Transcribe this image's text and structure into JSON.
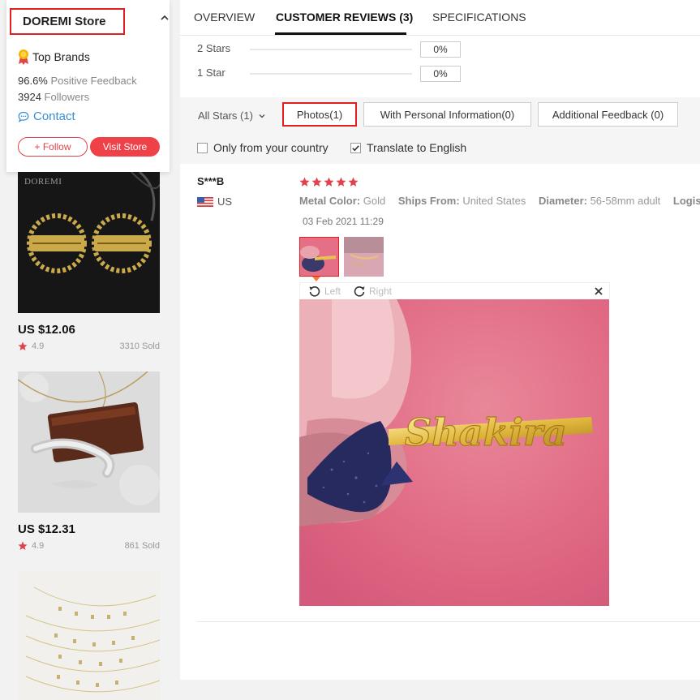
{
  "store": {
    "name": "DOREMI Store",
    "badge_label": "Top Brands",
    "positive_value": "96.6%",
    "positive_label": "Positive Feedback",
    "followers_value": "3924",
    "followers_label": "Followers",
    "contact_label": "Contact",
    "follow_label": "+ Follow",
    "visit_label": "Visit Store"
  },
  "products": [
    {
      "price": "US $12.06",
      "rating": "4.9",
      "sold": "3310 Sold",
      "image_watermark": "DOREMI"
    },
    {
      "price": "US $12.31",
      "rating": "4.9",
      "sold": "861 Sold"
    },
    {}
  ],
  "tabs": [
    {
      "label": "OVERVIEW",
      "active": false
    },
    {
      "label": "CUSTOMER REVIEWS (3)",
      "active": true
    },
    {
      "label": "SPECIFICATIONS",
      "active": false
    }
  ],
  "star_breakdown": [
    {
      "label": "2 Stars",
      "percent": "0%"
    },
    {
      "label": "1 Star",
      "percent": "0%"
    }
  ],
  "filters": {
    "all_stars": "All Stars (1)",
    "buttons": [
      "Photos(1)",
      "With Personal Information(0)",
      "Additional Feedback (0)"
    ],
    "only_country": {
      "label": "Only from your country",
      "checked": false
    },
    "translate": {
      "label": "Translate to English",
      "checked": true
    }
  },
  "review": {
    "reviewer": "S***B",
    "country": "US",
    "rating": 5,
    "attributes": [
      {
        "key": "Metal Color:",
        "value": "Gold"
      },
      {
        "key": "Ships From:",
        "value": "United States"
      },
      {
        "key": "Diameter:",
        "value": "56-58mm adult"
      },
      {
        "key": "Logisti",
        "value": ""
      }
    ],
    "date": "03 Feb 2021 11:29",
    "photo_count": 2
  },
  "viewer": {
    "rotate_left": "Left",
    "rotate_right": "Right",
    "photo_text": "Shakira"
  },
  "colors": {
    "accent_red": "#ef4148",
    "highlight_red": "#e02020",
    "link_blue": "#3a8fd3",
    "star_red": "#e0434a"
  }
}
